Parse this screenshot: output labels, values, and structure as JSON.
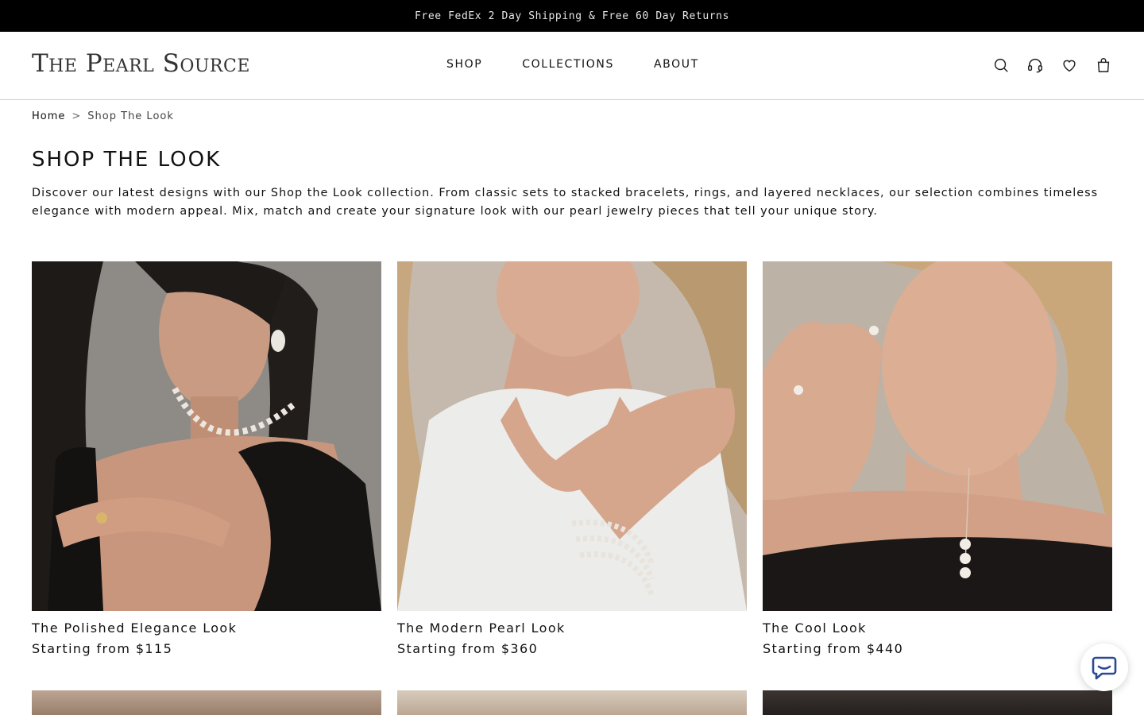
{
  "announcement": "Free FedEx 2 Day Shipping & Free 60 Day Returns",
  "brand": {
    "logo": "The Pearl Source"
  },
  "nav": [
    {
      "label": "SHOP"
    },
    {
      "label": "COLLECTIONS"
    },
    {
      "label": "ABOUT"
    }
  ],
  "header_icons": [
    "search-icon",
    "support-headset-icon",
    "wishlist-heart-icon",
    "cart-bag-icon"
  ],
  "breadcrumb": {
    "home": "Home",
    "separator": ">",
    "current": "Shop The Look"
  },
  "page": {
    "title": "SHOP THE LOOK",
    "description": "Discover our latest designs with our Shop the Look collection. From classic sets to stacked bracelets, rings, and layered necklaces, our selection combines timeless elegance with modern appeal. Mix, match and create your signature look with our pearl jewelry pieces that tell your unique story."
  },
  "products": [
    {
      "name": "The Polished Elegance Look",
      "price": "Starting from $115"
    },
    {
      "name": "The Modern Pearl Look",
      "price": "Starting from $360"
    },
    {
      "name": "The Cool Look",
      "price": "Starting from $440"
    }
  ],
  "colors": {
    "announce_bg": "#000000",
    "text": "#111111",
    "border": "#cfcfcf"
  }
}
